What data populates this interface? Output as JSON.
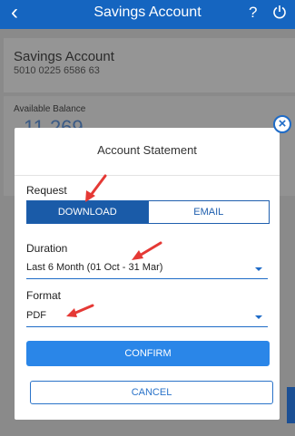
{
  "header": {
    "title": "Savings Account",
    "back_icon": "chevron-left-icon",
    "help_label": "?",
    "power_icon": "power-icon"
  },
  "account": {
    "name": "Savings Account",
    "number": "5010 0225 6586 63",
    "balance_label": "Available Balance",
    "balance_value": "11,269"
  },
  "modal": {
    "title": "Account Statement",
    "request_label": "Request",
    "options": [
      "DOWNLOAD",
      "EMAIL"
    ],
    "selected_option": "DOWNLOAD",
    "duration_label": "Duration",
    "duration_value": "Last 6 Month (01 Oct - 31 Mar)",
    "format_label": "Format",
    "format_value": "PDF",
    "confirm_label": "CONFIRM",
    "cancel_label": "CANCEL",
    "close_label": "×"
  },
  "colors": {
    "header": "#1565c0",
    "accent": "#1a5ba8",
    "confirm": "#2a86e8",
    "annotation_arrow": "#e53935"
  }
}
